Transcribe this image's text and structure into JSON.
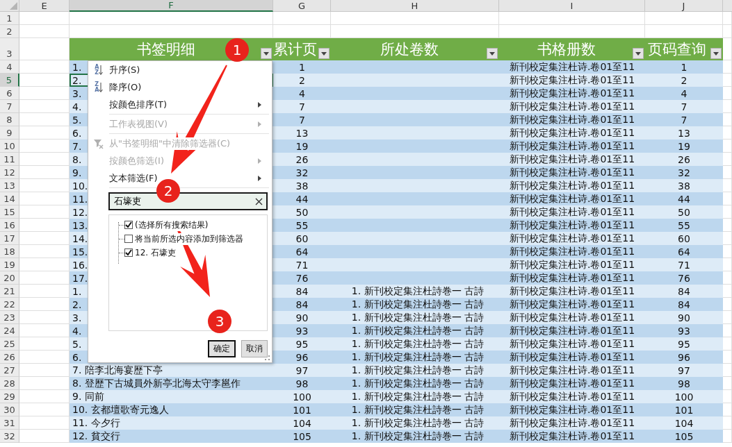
{
  "column_headers": [
    {
      "label": "E",
      "selected": false
    },
    {
      "label": "F",
      "selected": true
    },
    {
      "label": "G",
      "selected": false
    },
    {
      "label": "H",
      "selected": false
    },
    {
      "label": "I",
      "selected": false
    },
    {
      "label": "J",
      "selected": false
    }
  ],
  "top_rows": [
    {
      "number": "1"
    },
    {
      "number": "2"
    }
  ],
  "table": {
    "row_number": "3",
    "headers": [
      "书签明细",
      "累计页",
      "所处卷数",
      "书格册数",
      "页码查询"
    ],
    "rows": [
      {
        "number": "4",
        "selected": false,
        "f": "1.",
        "g": "1",
        "i": "新刊校定集注杜诗.卷01至11",
        "j": "1"
      },
      {
        "number": "5",
        "selected": true,
        "f": "2.",
        "g": "2",
        "i": "新刊校定集注杜诗.卷01至11",
        "j": "2"
      },
      {
        "number": "6",
        "selected": false,
        "f": "3.",
        "g": "4",
        "i": "新刊校定集注杜诗.卷01至11",
        "j": "4"
      },
      {
        "number": "7",
        "selected": false,
        "f": "4.",
        "g": "7",
        "i": "新刊校定集注杜诗.卷01至11",
        "j": "7"
      },
      {
        "number": "8",
        "selected": false,
        "f": "5.",
        "g": "7",
        "i": "新刊校定集注杜诗.卷01至11",
        "j": "7"
      },
      {
        "number": "9",
        "selected": false,
        "f": "6.",
        "g": "13",
        "i": "新刊校定集注杜诗.卷01至11",
        "j": "13"
      },
      {
        "number": "10",
        "selected": false,
        "f": "7.",
        "g": "19",
        "i": "新刊校定集注杜诗.卷01至11",
        "j": "19"
      },
      {
        "number": "11",
        "selected": false,
        "f": "8.",
        "g": "26",
        "i": "新刊校定集注杜诗.卷01至11",
        "j": "26"
      },
      {
        "number": "12",
        "selected": false,
        "f": "9.",
        "g": "32",
        "i": "新刊校定集注杜诗.卷01至11",
        "j": "32"
      },
      {
        "number": "13",
        "selected": false,
        "f": "10.",
        "g": "38",
        "i": "新刊校定集注杜诗.卷01至11",
        "j": "38"
      },
      {
        "number": "14",
        "selected": false,
        "f": "11.",
        "g": "44",
        "i": "新刊校定集注杜诗.卷01至11",
        "j": "44"
      },
      {
        "number": "15",
        "selected": false,
        "f": "12.",
        "g": "50",
        "i": "新刊校定集注杜诗.卷01至11",
        "j": "50"
      },
      {
        "number": "16",
        "selected": false,
        "f": "13.",
        "g": "55",
        "i": "新刊校定集注杜诗.卷01至11",
        "j": "55"
      },
      {
        "number": "17",
        "selected": false,
        "f": "14.",
        "g": "60",
        "i": "新刊校定集注杜诗.卷01至11",
        "j": "60"
      },
      {
        "number": "18",
        "selected": false,
        "f": "15.",
        "g": "64",
        "i": "新刊校定集注杜诗.卷01至11",
        "j": "64"
      },
      {
        "number": "19",
        "selected": false,
        "f": "16.",
        "g": "71",
        "i": "新刊校定集注杜诗.卷01至11",
        "j": "71"
      },
      {
        "number": "20",
        "selected": false,
        "f": "17.",
        "g": "76",
        "i": "新刊校定集注杜诗.卷01至11",
        "j": "76"
      },
      {
        "number": "21",
        "selected": false,
        "f": "1.",
        "g": "84",
        "h": "1. 新刊校定集注杜詩巻一 古詩",
        "i": "新刊校定集注杜诗.卷01至11",
        "j": "84"
      },
      {
        "number": "22",
        "selected": false,
        "f": "2.",
        "g": "84",
        "h": "1. 新刊校定集注杜詩巻一 古詩",
        "i": "新刊校定集注杜诗.卷01至11",
        "j": "84"
      },
      {
        "number": "23",
        "selected": false,
        "f": "3.",
        "g": "90",
        "h": "1. 新刊校定集注杜詩巻一 古詩",
        "i": "新刊校定集注杜诗.卷01至11",
        "j": "90"
      },
      {
        "number": "24",
        "selected": false,
        "f": "4.",
        "g": "93",
        "h": "1. 新刊校定集注杜詩巻一 古詩",
        "i": "新刊校定集注杜诗.卷01至11",
        "j": "93"
      },
      {
        "number": "25",
        "selected": false,
        "f": "5.",
        "g": "95",
        "h": "1. 新刊校定集注杜詩巻一 古詩",
        "i": "新刊校定集注杜诗.卷01至11",
        "j": "95"
      },
      {
        "number": "26",
        "selected": false,
        "f": "6.",
        "g": "96",
        "h": "1. 新刊校定集注杜詩巻一 古詩",
        "i": "新刊校定集注杜诗.卷01至11",
        "j": "96"
      },
      {
        "number": "27",
        "selected": false,
        "f": "7. 陪李北海宴歷下亭",
        "g": "97",
        "h": "1. 新刊校定集注杜詩巻一 古詩",
        "i": "新刊校定集注杜诗.卷01至11",
        "j": "97"
      },
      {
        "number": "28",
        "selected": false,
        "f": "8. 登歷下古城員外新亭北海太守李邕作",
        "g": "98",
        "h": "1. 新刊校定集注杜詩巻一 古詩",
        "i": "新刊校定集注杜诗.卷01至11",
        "j": "98"
      },
      {
        "number": "29",
        "selected": false,
        "f": "9. 同前",
        "g": "100",
        "h": "1. 新刊校定集注杜詩巻一 古詩",
        "i": "新刊校定集注杜诗.卷01至11",
        "j": "100"
      },
      {
        "number": "30",
        "selected": false,
        "f": "10. 玄都壇歌寄元逸人",
        "g": "101",
        "h": "1. 新刊校定集注杜詩巻一 古詩",
        "i": "新刊校定集注杜诗.卷01至11",
        "j": "101"
      },
      {
        "number": "31",
        "selected": false,
        "f": "11. 今夕行",
        "g": "104",
        "h": "1. 新刊校定集注杜詩巻一 古詩",
        "i": "新刊校定集注杜诗.卷01至11",
        "j": "104"
      },
      {
        "number": "32",
        "selected": false,
        "f": "12. 貧交行",
        "g": "105",
        "h": "1. 新刊校定集注杜詩巻一 古詩",
        "i": "新刊校定集注杜诗.卷01至11",
        "j": "105"
      }
    ]
  },
  "filter_menu": {
    "items": [
      {
        "kind": "sort",
        "label": "升序(S)",
        "icon_letters": "AZ",
        "disabled": false,
        "submenu": false
      },
      {
        "kind": "sort",
        "label": "降序(O)",
        "icon_letters": "ZA",
        "disabled": false,
        "submenu": false
      },
      {
        "kind": "command",
        "label": "按颜色排序(T)",
        "disabled": false,
        "submenu": true
      },
      {
        "kind": "separator"
      },
      {
        "kind": "command",
        "label": "工作表视图(V)",
        "disabled": true,
        "submenu": true
      },
      {
        "kind": "separator"
      },
      {
        "kind": "clear_filter",
        "label": "从\"书签明细\"中清除筛选器(C)",
        "disabled": true,
        "submenu": false
      },
      {
        "kind": "command",
        "label": "按颜色筛选(I)",
        "disabled": true,
        "submenu": true
      },
      {
        "kind": "command",
        "label": "文本筛选(F)",
        "disabled": false,
        "submenu": true
      },
      {
        "kind": "separator"
      }
    ],
    "search": {
      "value": "石壕吏"
    },
    "options": [
      {
        "label": "(选择所有搜索结果)",
        "checked": true
      },
      {
        "label": "将当前所选内容添加到筛选器",
        "checked": false
      },
      {
        "label": "12. 石壕吏",
        "checked": true
      }
    ],
    "buttons": [
      {
        "label": "确定",
        "default": true
      },
      {
        "label": "取消",
        "default": false
      }
    ]
  },
  "callouts": [
    "1",
    "2",
    "3"
  ]
}
